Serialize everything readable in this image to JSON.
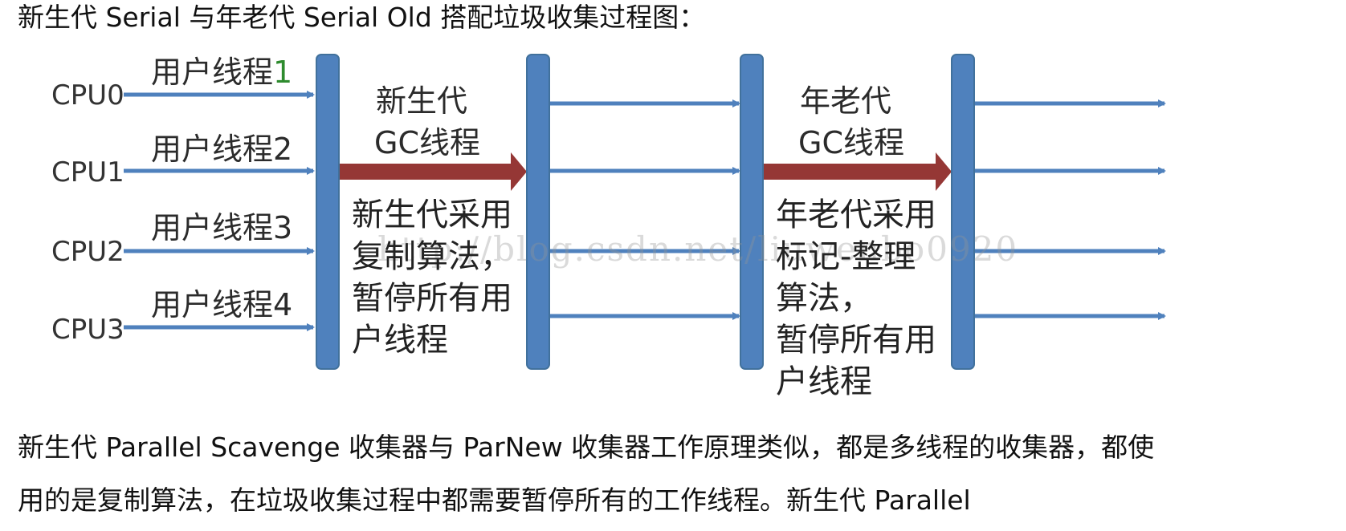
{
  "heading": "新生代 Serial 与年老代 Serial Old 搭配垃圾收集过程图：",
  "figure": {
    "cpus": [
      "CPU0",
      "CPU1",
      "CPU2",
      "CPU3"
    ],
    "threads": [
      {
        "label": "用户线程",
        "num": "1"
      },
      {
        "label": "用户线程",
        "num": "2"
      },
      {
        "label": "用户线程",
        "num": "3"
      },
      {
        "label": "用户线程",
        "num": "4"
      }
    ],
    "young_gc_title_line1": "新生代",
    "young_gc_title_line2": "GC线程",
    "young_gc_desc": "新生代采用\n复制算法，\n暂停所有用\n户线程",
    "old_gc_title_line1": "年老代",
    "old_gc_title_line2": "GC线程",
    "old_gc_desc": "年老代采用\n标记-整理\n算法，\n暂停所有用\n户线程",
    "watermark": "http://blog.csdn.net/liuwenbo0920",
    "colors": {
      "bar": "#4f81bd",
      "arrow": "#4f81bd",
      "gc_arrow": "#953735"
    }
  },
  "para1": "新生代 Parallel Scavenge 收集器与 ParNew 收集器工作原理类似，都是多线程的收集器，都使",
  "para2": "用的是复制算法，在垃圾收集过程中都需要暂停所有的工作线程。新生代 Parallel"
}
